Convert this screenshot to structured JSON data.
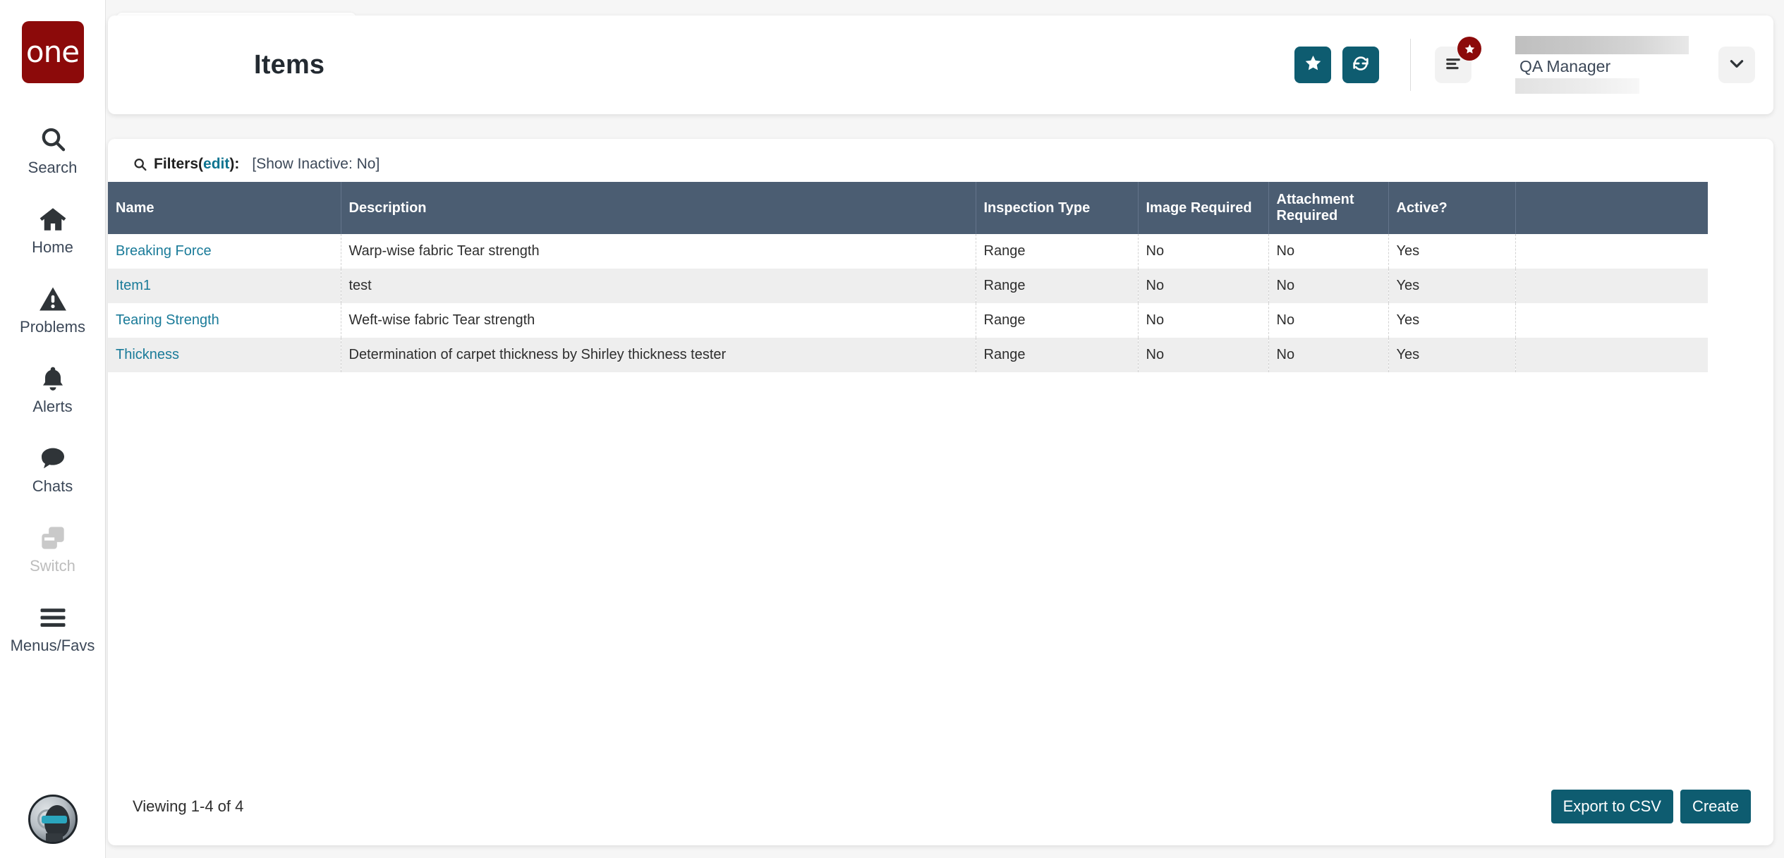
{
  "brand": {
    "logo_text": "one",
    "logo_color": "#8c0a0a"
  },
  "theme": {
    "accent": "#0e5c70",
    "table_header": "#4b5d72",
    "link": "#1a7b99"
  },
  "sidebar": {
    "items": [
      {
        "label": "Search",
        "icon": "search-icon",
        "disabled": false
      },
      {
        "label": "Home",
        "icon": "home-icon",
        "disabled": false
      },
      {
        "label": "Problems",
        "icon": "warning-triangle-icon",
        "disabled": false
      },
      {
        "label": "Alerts",
        "icon": "bell-icon",
        "disabled": false
      },
      {
        "label": "Chats",
        "icon": "chat-bubble-icon",
        "disabled": false
      },
      {
        "label": "Switch",
        "icon": "switch-cards-icon",
        "disabled": true
      },
      {
        "label": "Menus/Favs",
        "icon": "hamburger-icon",
        "disabled": false
      }
    ]
  },
  "tab": {
    "label": "Items"
  },
  "header": {
    "title": "Items",
    "favorite_icon": "star-icon",
    "refresh_icon": "refresh-icon",
    "menu_icon": "list-menu-icon",
    "badge_icon": "star-icon",
    "user_role": "QA Manager",
    "caret_icon": "chevron-down-icon"
  },
  "filters": {
    "icon": "search-icon",
    "label": "Filters",
    "open_paren": "(",
    "edit_label": "edit",
    "close_paren": "):",
    "value": "[Show Inactive: No]"
  },
  "table": {
    "columns": [
      "Name",
      "Description",
      "Inspection Type",
      "Image Required",
      "Attachment Required",
      ""
    ],
    "rows": [
      {
        "name": "Breaking Force",
        "description": "Warp-wise fabric Tear strength",
        "inspection_type": "Range",
        "image_required": "No",
        "attachment_required": "No",
        "active": "Yes"
      },
      {
        "name": "Item1",
        "description": "test",
        "inspection_type": "Range",
        "image_required": "No",
        "attachment_required": "No",
        "active": "Yes"
      },
      {
        "name": "Tearing Strength",
        "description": "Weft-wise fabric Tear strength",
        "inspection_type": "Range",
        "image_required": "No",
        "attachment_required": "No",
        "active": "Yes"
      },
      {
        "name": "Thickness",
        "description": "Determination of carpet thickness by Shirley thickness tester",
        "inspection_type": "Range",
        "image_required": "No",
        "attachment_required": "No",
        "active": "Yes"
      }
    ],
    "active_column": "Active?"
  },
  "footer": {
    "viewing": "Viewing 1-4 of 4",
    "export_label": "Export to CSV",
    "create_label": "Create"
  }
}
